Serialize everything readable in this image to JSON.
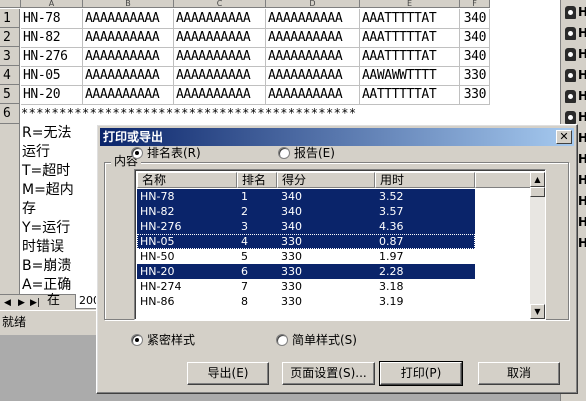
{
  "sheet": {
    "column_headers": [
      "A",
      "B",
      "C",
      "D",
      "E",
      "F"
    ],
    "rows": [
      {
        "num": "1",
        "a": "HN-78",
        "b": "AAAAAAAAAA",
        "c": "AAAAAAAAAA",
        "d": "AAAAAAAAAA",
        "e": "AAATTTTTAT",
        "f": "340"
      },
      {
        "num": "2",
        "a": "HN-82",
        "b": "AAAAAAAAAA",
        "c": "AAAAAAAAAA",
        "d": "AAAAAAAAAA",
        "e": "AAATTTTTAT",
        "f": "340"
      },
      {
        "num": "3",
        "a": "HN-276",
        "b": "AAAAAAAAAA",
        "c": "AAAAAAAAAA",
        "d": "AAAAAAAAAA",
        "e": "AAATTTTTAT",
        "f": "340"
      },
      {
        "num": "4",
        "a": "HN-05",
        "b": "AAAAAAAAAA",
        "c": "AAAAAAAAAA",
        "d": "AAAAAAAAAA",
        "e": "AAWAWWTTTT",
        "f": "330"
      },
      {
        "num": "5",
        "a": "HN-20",
        "b": "AAAAAAAAAA",
        "c": "AAAAAAAAAA",
        "d": "AAAAAAAAAA",
        "e": "AATTTTTTAT",
        "f": "330"
      }
    ],
    "row6_num": "6",
    "row6_text": "********************************************",
    "legend": [
      "R=无法",
      "运行",
      "T=超时",
      "M=超内",
      "存",
      "Y=运行",
      "时错误",
      "B=崩溃",
      "A=正确",
      "在"
    ],
    "tab_label": "200",
    "status": "就绪"
  },
  "right_strip": {
    "label": "H",
    "items": 12
  },
  "dialog": {
    "title": "打印或导出",
    "close_glyph": "✕",
    "group_label": "内容",
    "radio_ranking": "排名表(R)",
    "radio_report": "报告(E)",
    "list": {
      "headers": [
        "名称",
        "排名",
        "得分",
        "用时"
      ],
      "rows": [
        {
          "name": "HN-78",
          "rank": "1",
          "score": "340",
          "time": "3.52",
          "selected": true
        },
        {
          "name": "HN-82",
          "rank": "2",
          "score": "340",
          "time": "3.57",
          "selected": true
        },
        {
          "name": "HN-276",
          "rank": "3",
          "score": "340",
          "time": "4.36",
          "selected": true
        },
        {
          "name": "HN-05",
          "rank": "4",
          "score": "330",
          "time": "0.87",
          "selected": true
        },
        {
          "name": "HN-50",
          "rank": "5",
          "score": "330",
          "time": "1.97",
          "selected": false
        },
        {
          "name": "HN-20",
          "rank": "6",
          "score": "330",
          "time": "2.28",
          "selected": true
        },
        {
          "name": "HN-274",
          "rank": "7",
          "score": "330",
          "time": "3.18",
          "selected": false
        },
        {
          "name": "HN-86",
          "rank": "8",
          "score": "330",
          "time": "3.19",
          "selected": false
        }
      ]
    },
    "radio_compact": "紧密样式",
    "radio_simple": "简单样式(S)",
    "btn_export": "导出(E)",
    "btn_page_setup": "页面设置(S)...",
    "btn_print": "打印(P)",
    "btn_cancel": "取消",
    "colors": {
      "selection": "#0a246a",
      "title_start": "#0a246a",
      "title_end": "#a6caf0",
      "face": "#d4d0c8"
    }
  }
}
